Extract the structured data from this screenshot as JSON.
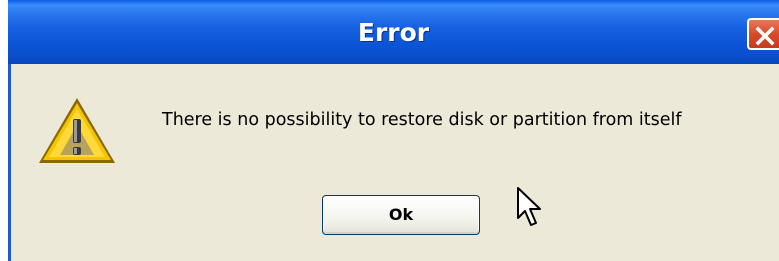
{
  "window": {
    "title": "Error"
  },
  "message": {
    "text": "There is no possibility to restore disk or partition from itself"
  },
  "buttons": {
    "ok_label": "Ok"
  },
  "icons": {
    "warning": "warning-icon",
    "close": "close-icon",
    "cursor": "mouse-pointer-icon"
  },
  "colors": {
    "titlebar": "#0b55d6",
    "dialog_bg": "#ece9d8",
    "close_button": "#d94a2a",
    "warning_yellow": "#f5c400"
  }
}
